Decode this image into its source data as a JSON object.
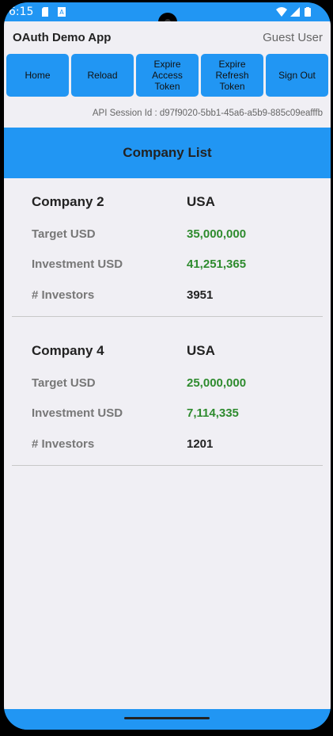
{
  "status": {
    "time": "6:15"
  },
  "app": {
    "title": "OAuth Demo App",
    "user": "Guest User"
  },
  "toolbar": {
    "home": "Home",
    "reload": "Reload",
    "expire_access": "Expire\nAccess\nToken",
    "expire_refresh": "Expire\nRefresh\nToken",
    "sign_out": "Sign Out"
  },
  "session": {
    "text": "API Session Id : d97f9020-5bb1-45a6-a5b9-885c09eafffb"
  },
  "list": {
    "title": "Company List"
  },
  "labels": {
    "target": "Target USD",
    "investment": "Investment USD",
    "investors": "# Investors"
  },
  "companies": [
    {
      "name": "Company 2",
      "country": "USA",
      "target": "35,000,000",
      "investment": "41,251,365",
      "investors": "3951"
    },
    {
      "name": "Company 4",
      "country": "USA",
      "target": "25,000,000",
      "investment": "7,114,335",
      "investors": "1201"
    }
  ],
  "colors": {
    "accent": "#2196f3",
    "money": "#2e8b2e",
    "background": "#f0eff4"
  }
}
